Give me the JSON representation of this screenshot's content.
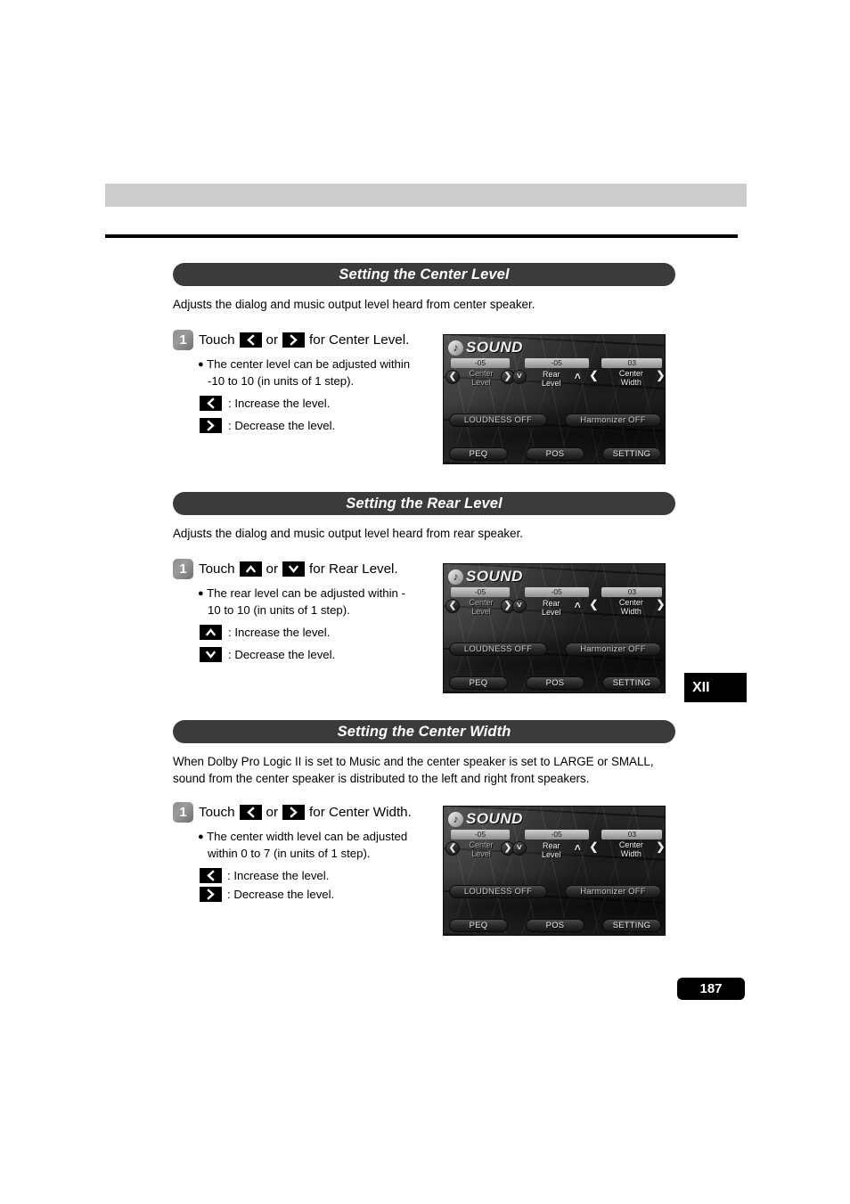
{
  "page": {
    "number": "187",
    "side_tab": "XII"
  },
  "sections": [
    {
      "title": "Setting the Center Level",
      "description": "Adjusts the dialog and music output level heard from center speaker.",
      "step_number": "1",
      "step_prefix": "Touch",
      "step_conjunction": "or",
      "step_suffix": "for Center Level.",
      "key_a": "<",
      "key_b": ">",
      "bullet_line1": "The center level can be adjusted within",
      "bullet_line2": "-10 to 10  (in units of 1 step).",
      "legend_increase": ": Increase the level.",
      "legend_decrease": ": Decrease the level."
    },
    {
      "title": "Setting the Rear Level",
      "description": "Adjusts the dialog and music output level heard from rear speaker.",
      "step_number": "1",
      "step_prefix": "Touch",
      "step_conjunction": "or",
      "step_suffix": "for Rear Level.",
      "key_a": "^",
      "key_b": "v",
      "bullet_line1": "The rear level can be adjusted within -",
      "bullet_line2": "10 to 10  (in units of 1 step).",
      "legend_increase": ": Increase the level.",
      "legend_decrease": ": Decrease the level."
    },
    {
      "title": "Setting the Center Width",
      "description": "When Dolby Pro Logic II is set to Music and the center speaker is set to LARGE or SMALL, sound from the center speaker is distributed to the left and right front speakers.",
      "step_number": "1",
      "step_prefix": "Touch",
      "step_conjunction": "or",
      "step_suffix": "for Center Width.",
      "key_a": "<",
      "key_b": ">",
      "bullet_line1": "The center width level can be adjusted",
      "bullet_line2": "within 0 to 7  (in units of 1 step).",
      "legend_increase": ": Increase the level.",
      "legend_decrease": ": Decrease the level."
    }
  ],
  "device": {
    "header_title": "SOUND",
    "header_icon": "music-note-icon",
    "params": [
      {
        "value": "-05",
        "label": "Center\nLevel",
        "left_arrow": "<",
        "right_arrow": ">"
      },
      {
        "value": "-05",
        "label": "Rear\nLevel",
        "left_arrow": "v",
        "right_arrow": "^"
      },
      {
        "value": "03",
        "label": "Center\nWidth",
        "left_arrow": "<",
        "right_arrow": ">"
      }
    ],
    "toggles": [
      {
        "label": "LOUDNESS OFF"
      },
      {
        "label": "Harmonizer OFF"
      }
    ],
    "bottom_buttons": [
      {
        "label": "PEQ"
      },
      {
        "label": "POS"
      },
      {
        "label": "SETTING"
      }
    ]
  }
}
